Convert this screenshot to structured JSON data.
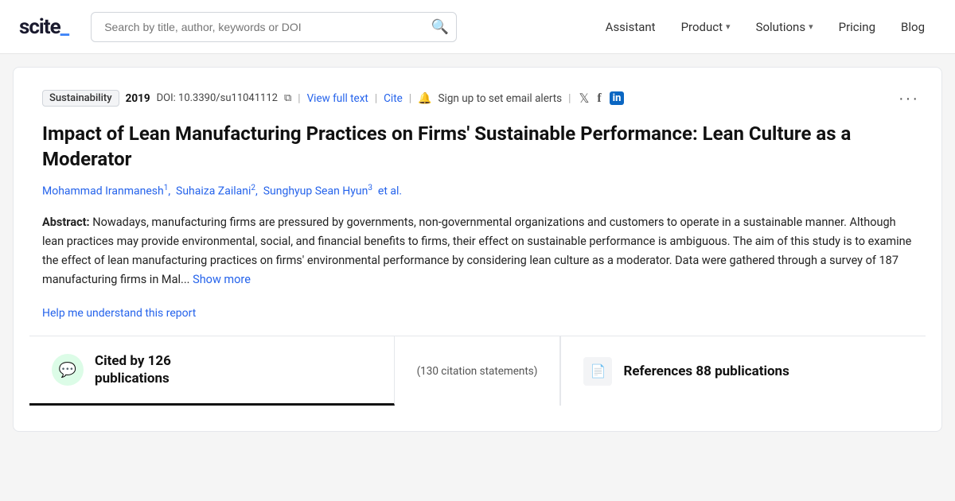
{
  "nav": {
    "logo": "scite_",
    "search_placeholder": "Search by title, author, keywords or DOI",
    "links": [
      {
        "label": "Assistant",
        "has_chevron": false
      },
      {
        "label": "Product",
        "has_chevron": true
      },
      {
        "label": "Solutions",
        "has_chevron": true
      },
      {
        "label": "Pricing",
        "has_chevron": false
      },
      {
        "label": "Blog",
        "has_chevron": false
      }
    ]
  },
  "paper": {
    "journal": "Sustainability",
    "year": "2019",
    "doi": "DOI: 10.3390/su11041112",
    "view_full_text": "View full text",
    "cite": "Cite",
    "alert_text": "Sign up to set email alerts",
    "title": "Impact of Lean Manufacturing Practices on Firms' Sustainable Performance: Lean Culture as a Moderator",
    "authors": [
      {
        "name": "Mohammad Iranmanesh",
        "sup": "1"
      },
      {
        "name": "Suhaiza Zailani",
        "sup": "2"
      },
      {
        "name": "Sunghyup Sean Hyun",
        "sup": "3"
      }
    ],
    "et_al": "et al.",
    "abstract_label": "Abstract:",
    "abstract_text": "Nowadays, manufacturing firms are pressured by governments, non-governmental organizations and customers to operate in a sustainable manner. Although lean practices may provide environmental, social, and financial benefits to firms, their effect on sustainable performance is ambiguous. The aim of this study is to examine the effect of lean manufacturing practices on firms' environmental performance by considering lean culture as a moderator. Data were gathered through a survey of 187 manufacturing firms in Mal...",
    "show_more": "Show more",
    "help_link": "Help me understand this report"
  },
  "stats": {
    "cited_label": "Cited by 126 publications",
    "cited_main_line1": "Cited by 126",
    "cited_main_line2": "publications",
    "citation_statements": "(130 citation statements)",
    "references_label": "References 88 publications",
    "references_main": "References 88 publications"
  },
  "icons": {
    "search": "🔍",
    "bell": "🔔",
    "copy": "⧉",
    "twitter": "𝕏",
    "facebook": "f",
    "linkedin": "in",
    "bubble": "💬",
    "doc": "📄",
    "more": "···"
  }
}
